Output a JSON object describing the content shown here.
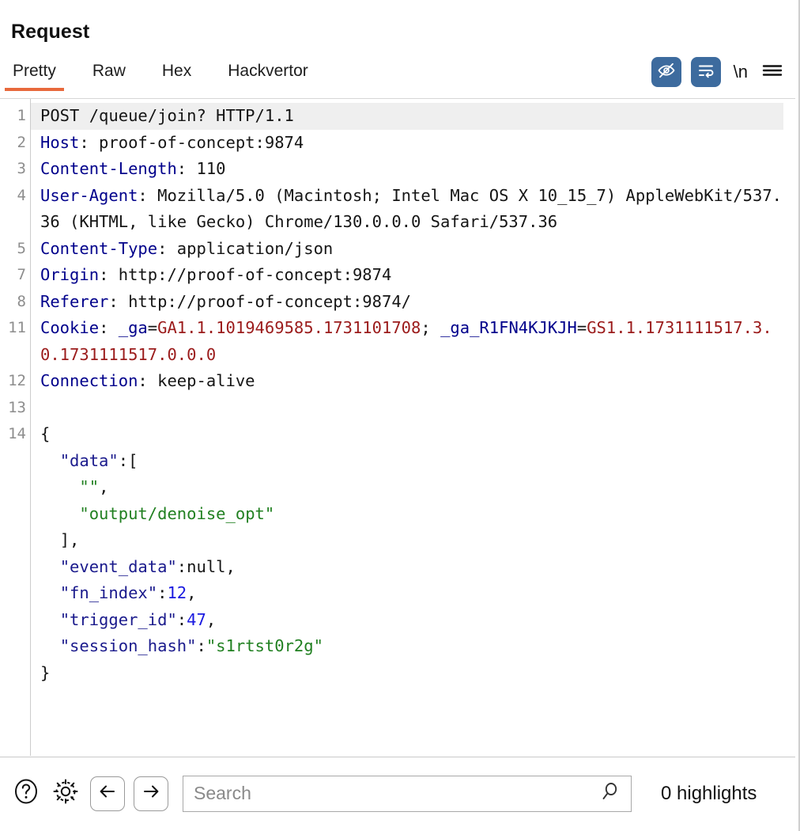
{
  "panel": {
    "title": "Request"
  },
  "tabs": [
    {
      "label": "Pretty",
      "active": true
    },
    {
      "label": "Raw",
      "active": false
    },
    {
      "label": "Hex",
      "active": false
    },
    {
      "label": "Hackvertor",
      "active": false
    }
  ],
  "tab_actions": {
    "hide_icon": "eye-slash-icon",
    "wrap_icon": "word-wrap-icon",
    "newline_label": "\\n",
    "menu_icon": "hamburger-menu-icon",
    "active_button_color": "#3d6b9e",
    "accent_color": "#e8693c"
  },
  "editor": {
    "lines": [
      {
        "no": "1",
        "highlighted": true,
        "segments": [
          {
            "text": "POST /queue/join? HTTP/1.1",
            "style": "val"
          }
        ]
      },
      {
        "no": "2",
        "highlighted": false,
        "segments": [
          {
            "text": "Host",
            "style": "hdr"
          },
          {
            "text": ": proof-of-concept:9874",
            "style": "val"
          }
        ]
      },
      {
        "no": "3",
        "highlighted": false,
        "segments": [
          {
            "text": "Content-Length",
            "style": "hdr"
          },
          {
            "text": ": 110",
            "style": "val"
          }
        ]
      },
      {
        "no": "4",
        "highlighted": false,
        "segments": [
          {
            "text": "User-Agent",
            "style": "hdr"
          },
          {
            "text": ": Mozilla/5.0 (Macintosh; Intel Mac OS X 10_15_7) AppleWebKit/537.36 (KHTML, like Gecko) Chrome/130.0.0.0 Safari/537.36",
            "style": "val"
          }
        ]
      },
      {
        "no": "5",
        "highlighted": false,
        "segments": [
          {
            "text": "Content-Type",
            "style": "hdr"
          },
          {
            "text": ": application/json",
            "style": "val"
          }
        ]
      },
      {
        "no": "7",
        "highlighted": false,
        "segments": [
          {
            "text": "Origin",
            "style": "hdr"
          },
          {
            "text": ": http://proof-of-concept:9874",
            "style": "val"
          }
        ]
      },
      {
        "no": "8",
        "highlighted": false,
        "segments": [
          {
            "text": "Referer",
            "style": "hdr"
          },
          {
            "text": ": http://proof-of-concept:9874/",
            "style": "val"
          }
        ]
      },
      {
        "no": "11",
        "highlighted": false,
        "segments": [
          {
            "text": "Cookie",
            "style": "hdr"
          },
          {
            "text": ": ",
            "style": "val"
          },
          {
            "text": "_ga",
            "style": "ckn"
          },
          {
            "text": "=",
            "style": "val"
          },
          {
            "text": "GA1.1.1019469585.1731101708",
            "style": "ckv"
          },
          {
            "text": "; ",
            "style": "val"
          },
          {
            "text": "_ga_R1FN4KJKJH",
            "style": "ckn"
          },
          {
            "text": "=",
            "style": "val"
          },
          {
            "text": "GS1.1.1731111517.3.0.1731111517.0.0.0",
            "style": "ckv"
          }
        ]
      },
      {
        "no": "12",
        "highlighted": false,
        "segments": [
          {
            "text": "Connection",
            "style": "hdr"
          },
          {
            "text": ": keep-alive",
            "style": "val"
          }
        ]
      },
      {
        "no": "13",
        "highlighted": false,
        "segments": [
          {
            "text": "",
            "style": "val"
          }
        ]
      },
      {
        "no": "14",
        "highlighted": false,
        "segments": [
          {
            "text": "{",
            "style": "jpun"
          }
        ]
      },
      {
        "no": "",
        "highlighted": false,
        "segments": [
          {
            "text": "  ",
            "style": "jpun"
          },
          {
            "text": "\"data\"",
            "style": "jkey"
          },
          {
            "text": ":[",
            "style": "jpun"
          }
        ]
      },
      {
        "no": "",
        "highlighted": false,
        "segments": [
          {
            "text": "    ",
            "style": "jpun"
          },
          {
            "text": "\"\"",
            "style": "jstr"
          },
          {
            "text": ",",
            "style": "jpun"
          }
        ]
      },
      {
        "no": "",
        "highlighted": false,
        "segments": [
          {
            "text": "    ",
            "style": "jpun"
          },
          {
            "text": "\"output/denoise_opt\"",
            "style": "jstr"
          }
        ]
      },
      {
        "no": "",
        "highlighted": false,
        "segments": [
          {
            "text": "  ],",
            "style": "jpun"
          }
        ]
      },
      {
        "no": "",
        "highlighted": false,
        "segments": [
          {
            "text": "  ",
            "style": "jpun"
          },
          {
            "text": "\"event_data\"",
            "style": "jkey"
          },
          {
            "text": ":null,",
            "style": "jpun"
          }
        ]
      },
      {
        "no": "",
        "highlighted": false,
        "segments": [
          {
            "text": "  ",
            "style": "jpun"
          },
          {
            "text": "\"fn_index\"",
            "style": "jkey"
          },
          {
            "text": ":",
            "style": "jpun"
          },
          {
            "text": "12",
            "style": "jnum"
          },
          {
            "text": ",",
            "style": "jpun"
          }
        ]
      },
      {
        "no": "",
        "highlighted": false,
        "segments": [
          {
            "text": "  ",
            "style": "jpun"
          },
          {
            "text": "\"trigger_id\"",
            "style": "jkey"
          },
          {
            "text": ":",
            "style": "jpun"
          },
          {
            "text": "47",
            "style": "jnum"
          },
          {
            "text": ",",
            "style": "jpun"
          }
        ]
      },
      {
        "no": "",
        "highlighted": false,
        "segments": [
          {
            "text": "  ",
            "style": "jpun"
          },
          {
            "text": "\"session_hash\"",
            "style": "jkey"
          },
          {
            "text": ":",
            "style": "jpun"
          },
          {
            "text": "\"s1rtst0r2g\"",
            "style": "jstr"
          }
        ]
      },
      {
        "no": "",
        "highlighted": false,
        "segments": [
          {
            "text": "}",
            "style": "jpun"
          }
        ]
      }
    ]
  },
  "bottom": {
    "help_icon": "help-circle-icon",
    "settings_icon": "gear-icon",
    "back_icon": "arrow-left-icon",
    "forward_icon": "arrow-right-icon",
    "search_placeholder": "Search",
    "search_value": "",
    "search_icon": "magnifier-icon",
    "highlights_label": "0 highlights"
  }
}
